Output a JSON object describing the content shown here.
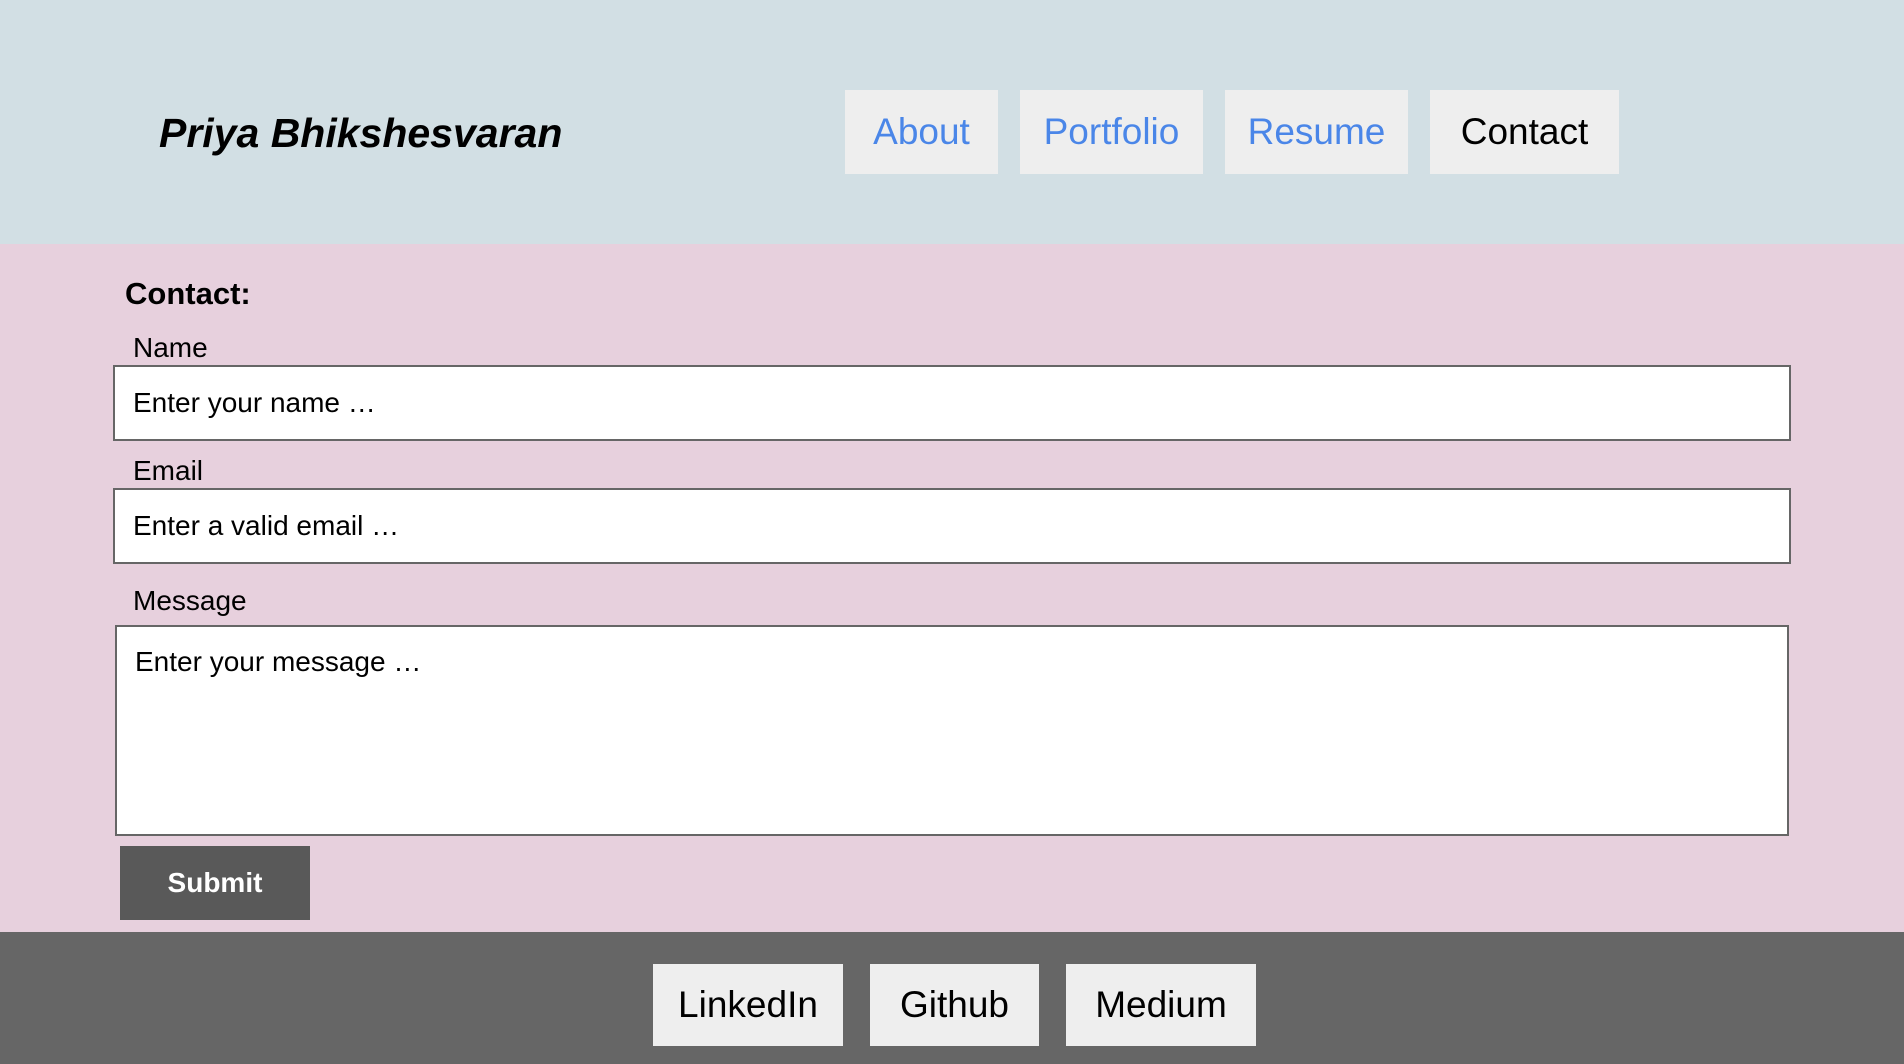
{
  "header": {
    "site_title": "Priya Bhikshesvaran",
    "nav": {
      "about": "About",
      "portfolio": "Portfolio",
      "resume": "Resume",
      "contact": "Contact"
    }
  },
  "contact_form": {
    "heading": "Contact:",
    "name": {
      "label": "Name",
      "placeholder": "Enter your name …",
      "value": ""
    },
    "email": {
      "label": "Email",
      "placeholder": "Enter a valid email …",
      "value": ""
    },
    "message": {
      "label": "Message",
      "placeholder": "Enter your message …",
      "value": ""
    },
    "submit_label": "Submit"
  },
  "footer": {
    "links": {
      "linkedin": "LinkedIn",
      "github": "Github",
      "medium": "Medium"
    }
  },
  "colors": {
    "header_bg": "#d2dfe4",
    "main_bg": "#e7d0dd",
    "footer_bg": "#666666",
    "link_blue": "#4a86e8",
    "button_gray": "#eeeeee",
    "submit_bg": "#595959"
  }
}
